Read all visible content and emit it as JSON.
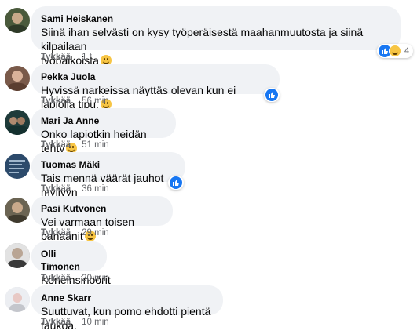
{
  "comments": [
    {
      "author": "Sami Heiskanen",
      "lines": [
        "Siinä ihan selvästi on kysy työperäisestä maahanmuutosta ja siinä kilpailaan",
        "työpaikoista"
      ],
      "emoji": "grinning-face-icon",
      "like_label": "Tykkää",
      "time": "1 t",
      "reactions": {
        "icons": [
          "like-icon",
          "haha-icon"
        ],
        "count": "4"
      },
      "avatar_color": "#4a5a3c"
    },
    {
      "author": "Pekka Juola",
      "lines": [
        "Hyvissä narkeissa näyttäs olevan kun ei lapiolla tipu."
      ],
      "emoji": "drooling-face-icon",
      "like_label": "Tykkää",
      "time": "56 min",
      "reactions": {
        "icons": [
          "like-icon"
        ],
        "count": ""
      },
      "avatar_color": "#7a5a4a"
    },
    {
      "author": "Mari Ja Anne",
      "lines": [
        "Onko lapiotkin heidän tehty"
      ],
      "emoji": "thinking-face-icon",
      "like_label": "Tykkää",
      "time": "51 min",
      "reactions": {
        "icons": [],
        "count": ""
      },
      "avatar_color": "#1f3b3a"
    },
    {
      "author": "Tuomas Mäki",
      "lines": [
        "Tais mennä väärät jauhot myllyyn"
      ],
      "emoji": "",
      "like_label": "Tykkää",
      "time": "36 min",
      "reactions": {
        "icons": [
          "like-icon"
        ],
        "count": ""
      },
      "avatar_color": "#2c4a6b"
    },
    {
      "author": "Pasi Kutvonen",
      "lines": [
        "Vei varmaan toisen banaanit"
      ],
      "emoji": "rofl-face-icon",
      "like_label": "Tykkää",
      "time": "29 min",
      "reactions": {
        "icons": [],
        "count": ""
      },
      "avatar_color": "#6b6453"
    },
    {
      "author": "Olli Timonen",
      "lines": [
        "Koneinsinöörit"
      ],
      "emoji": "",
      "like_label": "Tykkää",
      "time": "20 min",
      "reactions": {
        "icons": [],
        "count": ""
      },
      "avatar_color": "#8a8a8a"
    },
    {
      "author": "Anne Skarr",
      "lines": [
        "Suuttuvat, kun pomo ehdotti pientä taukoa."
      ],
      "emoji": "",
      "like_label": "Tykkää",
      "time": "10 min",
      "reactions": {
        "icons": [],
        "count": ""
      },
      "avatar_color": "#d8d8dc"
    }
  ],
  "colors": {
    "bubble": "#f0f2f5",
    "meta_text": "#65676b",
    "like_blue": "#1877f2"
  }
}
